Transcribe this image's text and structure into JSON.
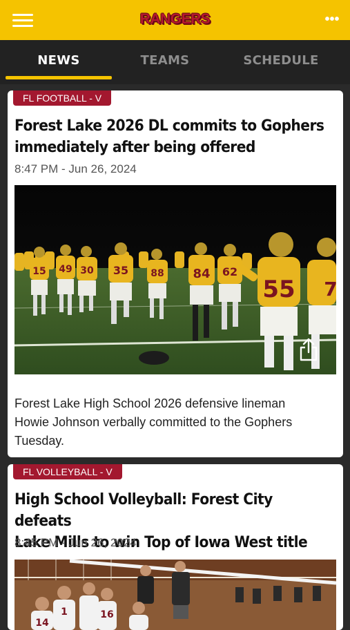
{
  "header": {
    "app_title": "RANGERS",
    "menu_icon": "hamburger-menu-icon",
    "more_icon": "more-dots-icon"
  },
  "tabs": [
    {
      "label": "NEWS",
      "active": true
    },
    {
      "label": "TEAMS",
      "active": false
    },
    {
      "label": "SCHEDULE",
      "active": false
    }
  ],
  "articles": [
    {
      "category": "FL FOOTBALL - V",
      "headline_line1": "Forest Lake 2026 DL commits to Gophers",
      "headline_line2": "immediately after being offered",
      "timestamp": "8:47 PM - Jun 26, 2024",
      "summary_line1": "Forest Lake High School 2026 defensive lineman",
      "summary_line2": "Howie Johnson verbally committed to the Gophers",
      "summary_line3": "Tuesday."
    },
    {
      "category": "FL VOLLEYBALL - V",
      "headline_line1": "High School Volleyball: Forest City defeats",
      "headline_line2": "Lake Mills to win Top of Iowa West title",
      "timestamp": "8:45 PM - Jun 26, 2024"
    }
  ],
  "photo1_jerseys": [
    "15",
    "49",
    "30",
    "35",
    "88",
    "84",
    "62",
    "55",
    "7"
  ],
  "photo2_jerseys": [
    "14",
    "1",
    "16"
  ],
  "colors": {
    "brand_gold": "#f5c300",
    "brand_maroon": "#a3182f",
    "tab_bar": "#222222"
  }
}
